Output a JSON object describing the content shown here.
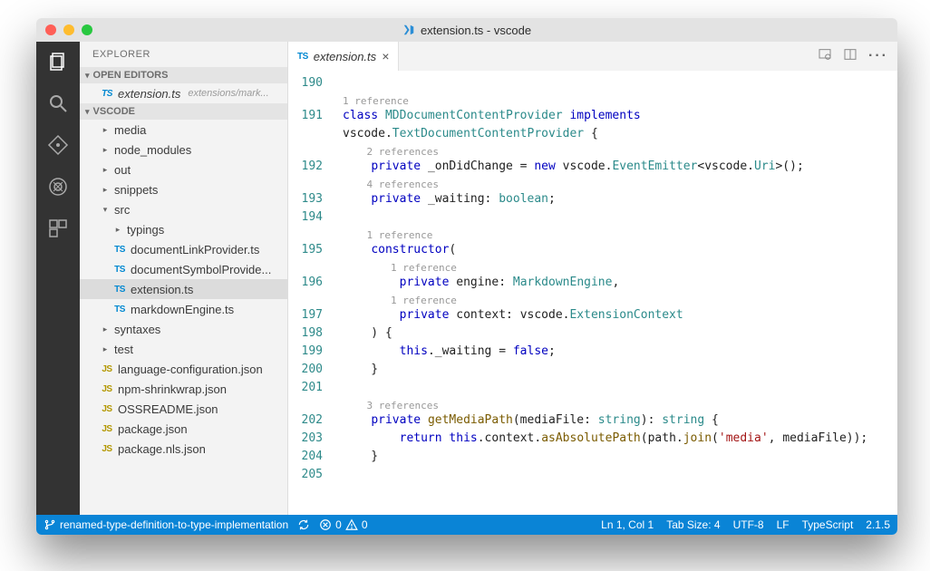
{
  "window": {
    "title": "extension.ts - vscode"
  },
  "sidebar": {
    "title": "EXPLORER",
    "openEditors": {
      "label": "OPEN EDITORS",
      "items": [
        {
          "name": "extension.ts",
          "detail": "extensions/mark..."
        }
      ]
    },
    "workspace": {
      "label": "VSCODE",
      "tree": [
        {
          "name": "media",
          "type": "folder",
          "indent": 1,
          "expanded": false
        },
        {
          "name": "node_modules",
          "type": "folder",
          "indent": 1,
          "expanded": false
        },
        {
          "name": "out",
          "type": "folder",
          "indent": 1,
          "expanded": false
        },
        {
          "name": "snippets",
          "type": "folder",
          "indent": 1,
          "expanded": false
        },
        {
          "name": "src",
          "type": "folder",
          "indent": 1,
          "expanded": true
        },
        {
          "name": "typings",
          "type": "folder",
          "indent": 2,
          "expanded": false
        },
        {
          "name": "documentLinkProvider.ts",
          "type": "ts",
          "indent": 2
        },
        {
          "name": "documentSymbolProvide...",
          "type": "ts",
          "indent": 2
        },
        {
          "name": "extension.ts",
          "type": "ts",
          "indent": 2,
          "selected": true
        },
        {
          "name": "markdownEngine.ts",
          "type": "ts",
          "indent": 2
        },
        {
          "name": "syntaxes",
          "type": "folder",
          "indent": 1,
          "expanded": false
        },
        {
          "name": "test",
          "type": "folder",
          "indent": 1,
          "expanded": false
        },
        {
          "name": "language-configuration.json",
          "type": "js",
          "indent": 1
        },
        {
          "name": "npm-shrinkwrap.json",
          "type": "js",
          "indent": 1
        },
        {
          "name": "OSSREADME.json",
          "type": "js",
          "indent": 1
        },
        {
          "name": "package.json",
          "type": "js",
          "indent": 1
        },
        {
          "name": "package.nls.json",
          "type": "js",
          "indent": 1
        }
      ]
    }
  },
  "tabs": {
    "active": {
      "name": "extension.ts"
    }
  },
  "editor": {
    "topLine": "190",
    "lines": [
      {
        "lens": "1 reference",
        "lensIndent": 0
      },
      {
        "num": "191",
        "tokens": [
          [
            "kw",
            "class "
          ],
          [
            "type",
            "MDDocumentContentProvider "
          ],
          [
            "kw",
            "implements"
          ]
        ]
      },
      {
        "num": "",
        "tokens": [
          [
            "plain",
            "vscode."
          ],
          [
            "type",
            "TextDocumentContentProvider"
          ],
          [
            "plain",
            " {"
          ]
        ]
      },
      {
        "lens": "2 references",
        "lensIndent": 1
      },
      {
        "num": "192",
        "tokens": [
          [
            "plain",
            "    "
          ],
          [
            "kw",
            "private "
          ],
          [
            "plain",
            "_onDidChange = "
          ],
          [
            "kw",
            "new "
          ],
          [
            "plain",
            "vscode."
          ],
          [
            "type",
            "EventEmitter"
          ],
          [
            "plain",
            "<vscode."
          ],
          [
            "type",
            "Uri"
          ],
          [
            "plain",
            ">();"
          ]
        ]
      },
      {
        "lens": "4 references",
        "lensIndent": 1
      },
      {
        "num": "193",
        "tokens": [
          [
            "plain",
            "    "
          ],
          [
            "kw",
            "private "
          ],
          [
            "plain",
            "_waiting: "
          ],
          [
            "type",
            "boolean"
          ],
          [
            "plain",
            ";"
          ]
        ]
      },
      {
        "num": "194",
        "tokens": [
          [
            "plain",
            ""
          ]
        ]
      },
      {
        "lens": "1 reference",
        "lensIndent": 1
      },
      {
        "num": "195",
        "tokens": [
          [
            "plain",
            "    "
          ],
          [
            "kw",
            "constructor"
          ],
          [
            "plain",
            "("
          ]
        ]
      },
      {
        "lens": "1 reference",
        "lensIndent": 2
      },
      {
        "num": "196",
        "tokens": [
          [
            "plain",
            "        "
          ],
          [
            "kw",
            "private "
          ],
          [
            "plain",
            "engine: "
          ],
          [
            "type",
            "MarkdownEngine"
          ],
          [
            "plain",
            ","
          ]
        ]
      },
      {
        "lens": "1 reference",
        "lensIndent": 2
      },
      {
        "num": "197",
        "tokens": [
          [
            "plain",
            "        "
          ],
          [
            "kw",
            "private "
          ],
          [
            "plain",
            "context: vscode."
          ],
          [
            "type",
            "ExtensionContext"
          ]
        ]
      },
      {
        "num": "198",
        "tokens": [
          [
            "plain",
            "    ) {"
          ]
        ]
      },
      {
        "num": "199",
        "tokens": [
          [
            "plain",
            "        "
          ],
          [
            "kw",
            "this"
          ],
          [
            "plain",
            "._waiting = "
          ],
          [
            "kw",
            "false"
          ],
          [
            "plain",
            ";"
          ]
        ]
      },
      {
        "num": "200",
        "tokens": [
          [
            "plain",
            "    }"
          ]
        ]
      },
      {
        "num": "201",
        "tokens": [
          [
            "plain",
            ""
          ]
        ]
      },
      {
        "lens": "3 references",
        "lensIndent": 1
      },
      {
        "num": "202",
        "tokens": [
          [
            "plain",
            "    "
          ],
          [
            "kw",
            "private "
          ],
          [
            "func",
            "getMediaPath"
          ],
          [
            "plain",
            "(mediaFile: "
          ],
          [
            "type",
            "string"
          ],
          [
            "plain",
            "): "
          ],
          [
            "type",
            "string"
          ],
          [
            "plain",
            " {"
          ]
        ]
      },
      {
        "num": "203",
        "tokens": [
          [
            "plain",
            "        "
          ],
          [
            "kw",
            "return "
          ],
          [
            "kw",
            "this"
          ],
          [
            "plain",
            ".context."
          ],
          [
            "func",
            "asAbsolutePath"
          ],
          [
            "plain",
            "(path."
          ],
          [
            "func",
            "join"
          ],
          [
            "plain",
            "("
          ],
          [
            "str",
            "'media'"
          ],
          [
            "plain",
            ", mediaFile));"
          ]
        ]
      },
      {
        "num": "204",
        "tokens": [
          [
            "plain",
            "    }"
          ]
        ]
      },
      {
        "num": "205",
        "tokens": [
          [
            "plain",
            ""
          ]
        ]
      }
    ]
  },
  "status": {
    "branch": "renamed-type-definition-to-type-implementation",
    "errors": "0",
    "warnings": "0",
    "lineCol": "Ln 1, Col 1",
    "tabSize": "Tab Size: 4",
    "encoding": "UTF-8",
    "eol": "LF",
    "language": "TypeScript",
    "version": "2.1.5"
  }
}
